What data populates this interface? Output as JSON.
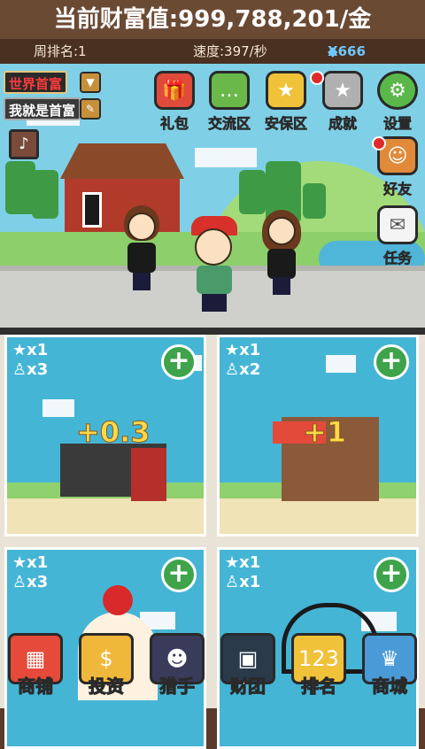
{
  "header": {
    "wealth_label": "当前财富值:999,788,201/金",
    "weekly_rank": "周排名:1",
    "speed": "速度:397/秒",
    "diamonds": "X666"
  },
  "scene": {
    "rank_tag_1": "世界首富",
    "rank_tag_2": "我就是首富",
    "buttons": [
      {
        "label": "礼包",
        "icon": "gift-icon"
      },
      {
        "label": "交流区",
        "icon": "chat-icon"
      },
      {
        "label": "安保区",
        "icon": "shield-icon"
      },
      {
        "label": "成就",
        "icon": "medal-icon"
      },
      {
        "label": "设置",
        "icon": "gear-icon"
      }
    ],
    "side_buttons": [
      {
        "label": "好友",
        "icon": "friend-icon"
      },
      {
        "label": "任务",
        "icon": "envelope-icon"
      }
    ]
  },
  "shops": [
    {
      "star": "x1",
      "staff": "x3",
      "gain": "+0.3"
    },
    {
      "star": "x1",
      "staff": "x2",
      "gain": "+1"
    },
    {
      "star": "x1",
      "staff": "x3",
      "gain": ""
    },
    {
      "star": "x1",
      "staff": "x1",
      "gain": ""
    }
  ],
  "nav": [
    {
      "label": "商铺",
      "icon": "storefront-icon"
    },
    {
      "label": "投资",
      "icon": "gold-bars-icon"
    },
    {
      "label": "猎手",
      "icon": "hunter-icon"
    },
    {
      "label": "财团",
      "icon": "vault-icon"
    },
    {
      "label": "排名",
      "icon": "podium-icon"
    },
    {
      "label": "商城",
      "icon": "shopping-icon"
    }
  ],
  "colors": {
    "header_bg": "#6b4a34",
    "plus_green": "#3ea34a",
    "gain_yellow": "#ffd84a",
    "rank_red": "#ff3a3a"
  }
}
